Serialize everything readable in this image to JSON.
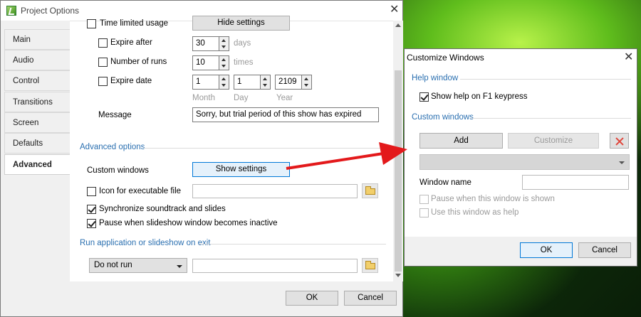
{
  "project_options": {
    "title": "Project Options",
    "tabs": [
      {
        "label": "Main"
      },
      {
        "label": "Audio"
      },
      {
        "label": "Control"
      },
      {
        "label": "Transitions"
      },
      {
        "label": "Screen"
      },
      {
        "label": "Defaults"
      },
      {
        "label": "Advanced",
        "active": true
      }
    ],
    "time_limited_usage": {
      "label": "Time limited usage",
      "checked": false
    },
    "hide_settings_label": "Hide settings",
    "expire_after": {
      "label": "Expire after",
      "value": "30",
      "unit": "days",
      "checked": false
    },
    "number_of_runs": {
      "label": "Number of runs",
      "value": "10",
      "unit": "times",
      "checked": false
    },
    "expire_date": {
      "label": "Expire date",
      "month": "1",
      "day": "1",
      "year": "2109",
      "checked": false
    },
    "date_labels": {
      "month": "Month",
      "day": "Day",
      "year": "Year"
    },
    "message": {
      "label": "Message",
      "value": "Sorry, but trial period of this show has expired"
    },
    "advanced_options_title": "Advanced options",
    "custom_windows": {
      "label": "Custom windows",
      "button": "Show settings"
    },
    "icon_for_executable": {
      "label": "Icon for executable file",
      "checked": false,
      "value": ""
    },
    "sync_soundtrack": {
      "label": "Synchronize soundtrack and slides",
      "checked": true
    },
    "pause_inactive": {
      "label": "Pause when slideshow window becomes inactive",
      "checked": true
    },
    "run_on_exit_title": "Run application or slideshow on exit",
    "run_on_exit": {
      "selected": "Do not run",
      "path": ""
    },
    "ok_label": "OK",
    "cancel_label": "Cancel",
    "close_icon": "close-icon"
  },
  "customize_windows": {
    "title": "Customize Windows",
    "help_window_title": "Help window",
    "show_help_f1": {
      "label": "Show help on F1 keypress",
      "checked": true
    },
    "custom_windows_title": "Custom windows",
    "add_label": "Add",
    "customize_label": "Customize",
    "delete_icon": "delete-x-icon",
    "window_select_value": "",
    "window_name": {
      "label": "Window name",
      "value": ""
    },
    "pause_when_shown": {
      "label": "Pause when this window is shown",
      "checked": false,
      "enabled": false
    },
    "use_as_help": {
      "label": "Use this window as help",
      "checked": false,
      "enabled": false
    },
    "ok_label": "OK",
    "cancel_label": "Cancel"
  },
  "colors": {
    "accent_blue": "#2a6fb0",
    "arrow_red": "#e3191b",
    "highlight_button": "#e5f1fb",
    "desktop_green": "#5fbd1c"
  }
}
